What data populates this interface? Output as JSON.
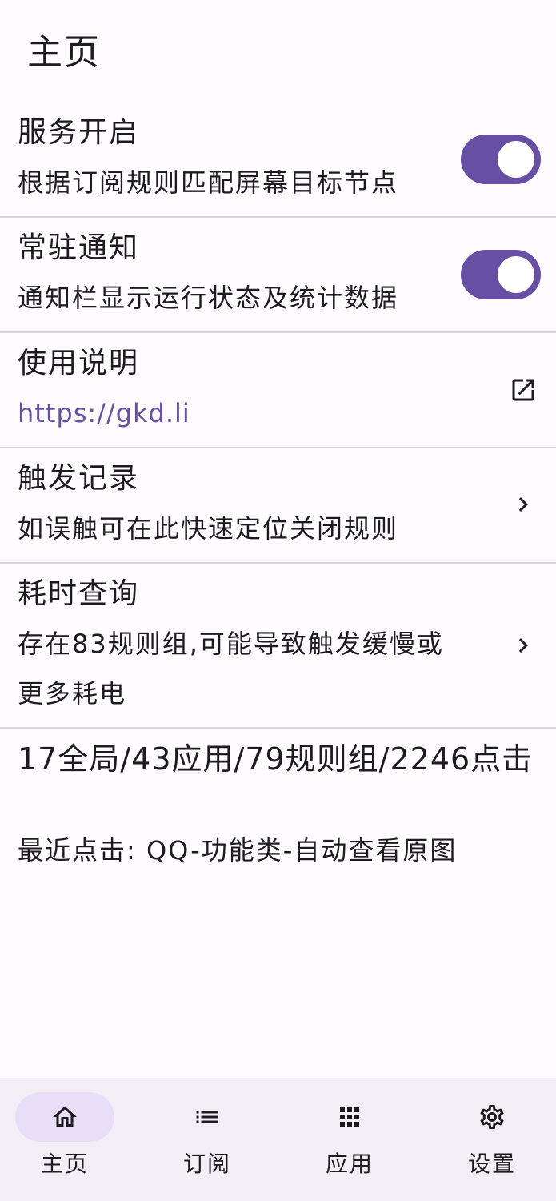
{
  "header": {
    "title": "主页"
  },
  "rows": {
    "service": {
      "title": "服务开启",
      "subtitle": "根据订阅规则匹配屏幕目标节点",
      "enabled": true
    },
    "notify": {
      "title": "常驻通知",
      "subtitle": "通知栏显示运行状态及统计数据",
      "enabled": true
    },
    "manual": {
      "title": "使用说明",
      "link": "https://gkd.li",
      "icon": "open-in-new-icon"
    },
    "records": {
      "title": "触发记录",
      "subtitle": "如误触可在此快速定位关闭规则",
      "icon": "chevron-right-icon"
    },
    "timing": {
      "title": "耗时查询",
      "subtitle_line1": "存在83规则组,可能导致触发缓慢或",
      "subtitle_line2": "更多耗电",
      "icon": "chevron-right-icon"
    },
    "stats": {
      "summary": "17全局/43应用/79规则组/2246点击",
      "recent": "最近点击: QQ-功能类-自动查看原图"
    }
  },
  "bottom_nav": {
    "items": [
      {
        "label": "主页",
        "icon": "home-icon",
        "active": true
      },
      {
        "label": "订阅",
        "icon": "list-icon",
        "active": false
      },
      {
        "label": "应用",
        "icon": "apps-grid-icon",
        "active": false
      },
      {
        "label": "设置",
        "icon": "gear-icon",
        "active": false
      }
    ]
  },
  "colors": {
    "accent": "#6750a4",
    "background": "#fffbfe",
    "nav_background": "#f3eef6",
    "active_pill": "#e8def8",
    "divider": "#d9d6dc"
  }
}
